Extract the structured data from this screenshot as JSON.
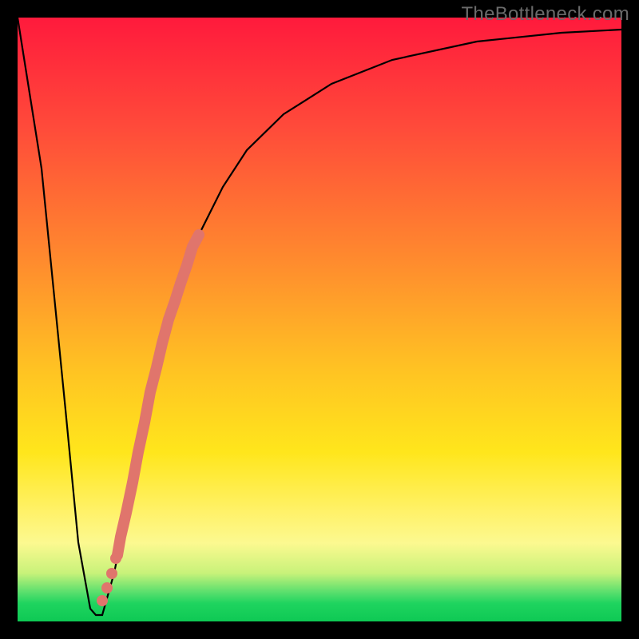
{
  "watermark": "TheBottleneck.com",
  "chart_data": {
    "type": "line",
    "title": "",
    "xlabel": "",
    "ylabel": "",
    "xlim": [
      0,
      100
    ],
    "ylim": [
      0,
      100
    ],
    "grid": false,
    "legend": false,
    "series": [
      {
        "name": "black-curve",
        "x": [
          0,
          4,
          8,
          10,
          12,
          13,
          14,
          16,
          18,
          20,
          22,
          24,
          26,
          30,
          34,
          38,
          44,
          52,
          62,
          76,
          90,
          100
        ],
        "y": [
          100,
          75,
          35,
          13,
          2,
          1,
          1,
          8,
          18,
          28,
          38,
          46,
          53,
          64,
          72,
          78,
          84,
          89,
          93,
          96,
          97.5,
          98
        ]
      },
      {
        "name": "red-overlay-band",
        "x": [
          16.5,
          17,
          18,
          19,
          20,
          21,
          22,
          23,
          24,
          25,
          26,
          27,
          28,
          29,
          30
        ],
        "y": [
          11,
          14,
          18,
          23,
          28,
          33,
          38,
          42,
          46,
          50,
          53,
          56,
          59,
          62,
          64
        ]
      },
      {
        "name": "red-dots",
        "x": [
          14.0,
          14.8,
          15.6,
          16.2
        ],
        "y": [
          3.5,
          5.5,
          8.0,
          10.5
        ]
      }
    ],
    "annotations": [
      {
        "text": "TheBottleneck.com",
        "pos": "top-right"
      }
    ]
  }
}
